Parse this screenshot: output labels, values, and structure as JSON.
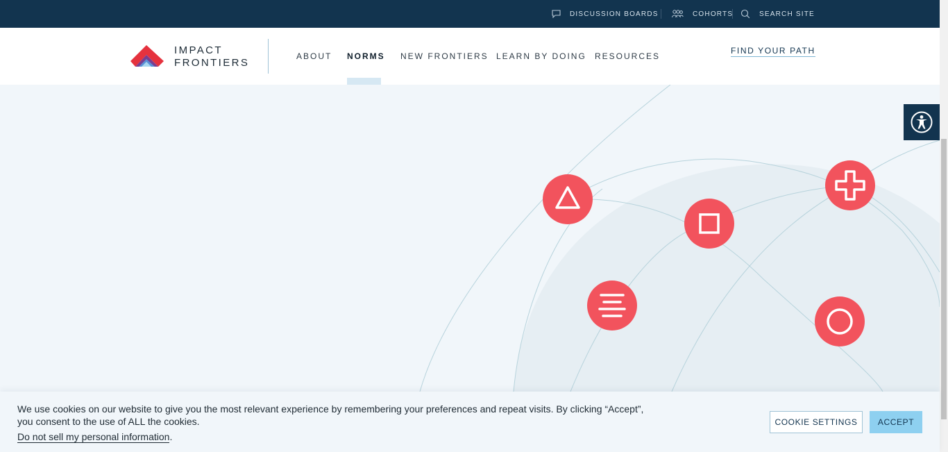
{
  "utility_bar": {
    "discussion_boards": "DISCUSSION BOARDS",
    "cohorts": "COHORTS",
    "search_site": "SEARCH SITE"
  },
  "logo": {
    "line1": "IMPACT",
    "line2": "FRONTIERS"
  },
  "nav": {
    "items": [
      {
        "label": "ABOUT"
      },
      {
        "label": "NORMS"
      },
      {
        "label": "NEW FRONTIERS"
      },
      {
        "label": "LEARN BY DOING"
      },
      {
        "label": "RESOURCES"
      }
    ],
    "active": "NORMS",
    "cta": "FIND YOUR PATH"
  },
  "hero": {
    "icons": [
      "triangle-icon",
      "square-icon",
      "plus-icon",
      "lines-icon",
      "circle-icon"
    ],
    "accent_color": "#f2535d"
  },
  "cookie_banner": {
    "message": "We use cookies on our website to give you the most relevant experience by remembering your preferences and repeat visits. By clicking “Accept”, you consent to the use of ALL the cookies.",
    "opt_out_link": "Do not sell my personal information",
    "opt_out_suffix": ".",
    "settings_button": "COOKIE SETTINGS",
    "accept_button": "ACCEPT"
  },
  "colors": {
    "navy": "#12344f",
    "hero_bg": "#f1f6fa",
    "accent": "#f2535d",
    "accept": "#8ed0f0"
  }
}
